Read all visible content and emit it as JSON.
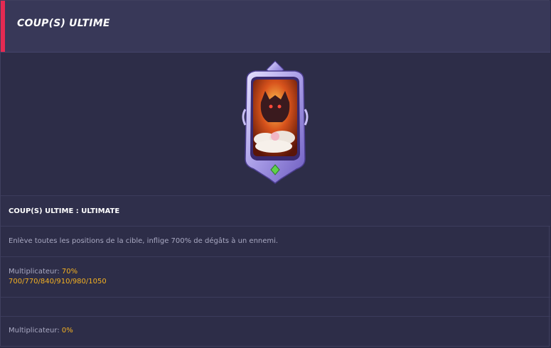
{
  "header": {
    "title": "COUP(S) ULTIME"
  },
  "card": {
    "frame_icon": "ornate-skill-card-icon",
    "gem_icon": "green-gem-icon"
  },
  "skill": {
    "name": "COUP(S) ULTIME : ULTIMATE"
  },
  "description": "Enlève toutes les positions de la cible, inflige 700% de dégâts à un ennemi.",
  "multiplier_1": {
    "label": "Multiplicateur: ",
    "value": "70%",
    "scaling": "700/770/840/910/980/1050"
  },
  "multiplier_2": {
    "label": "Multiplicateur: ",
    "value": "0%"
  },
  "colors": {
    "accent": "#e52a52",
    "highlight": "#f4b122",
    "background": "#2d2d48"
  }
}
